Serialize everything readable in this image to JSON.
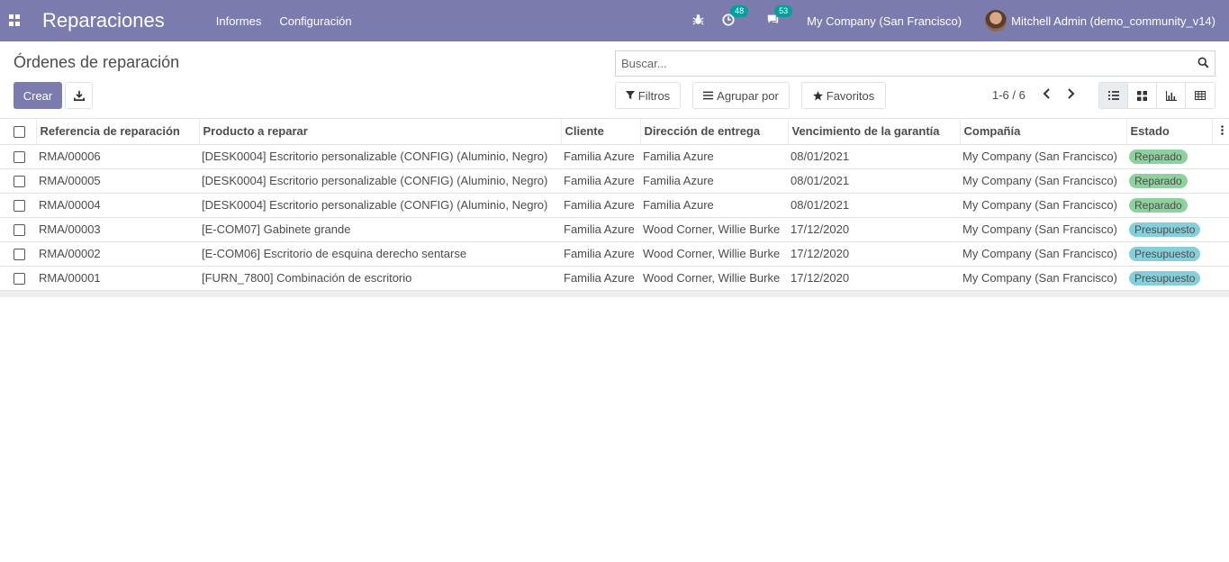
{
  "navbar": {
    "app_title": "Reparaciones",
    "menu": [
      "Informes",
      "Configuración"
    ],
    "activity_count": "48",
    "message_count": "53",
    "company": "My Company (San Francisco)",
    "user": "Mitchell Admin (demo_community_v14)",
    "color": "#7c7bad"
  },
  "control": {
    "breadcrumb": "Órdenes de reparación",
    "create_label": "Crear",
    "search_placeholder": "Buscar...",
    "filters_label": "Filtros",
    "group_by_label": "Agrupar por",
    "favorites_label": "Favoritos",
    "pager": "1-6 / 6"
  },
  "table": {
    "columns": [
      "Referencia de reparación",
      "Producto a reparar",
      "Cliente",
      "Dirección de entrega",
      "Vencimiento de la garantía",
      "Compañía",
      "Estado"
    ],
    "rows": [
      {
        "ref": "RMA/00006",
        "product": "[DESK0004] Escritorio personalizable (CONFIG) (Aluminio, Negro)",
        "client": "Familia Azure",
        "address": "Familia Azure",
        "warranty": "08/01/2021",
        "company": "My Company (San Francisco)",
        "status": "Reparado",
        "status_color": "#8fd19e"
      },
      {
        "ref": "RMA/00005",
        "product": "[DESK0004] Escritorio personalizable (CONFIG) (Aluminio, Negro)",
        "client": "Familia Azure",
        "address": "Familia Azure",
        "warranty": "08/01/2021",
        "company": "My Company (San Francisco)",
        "status": "Reparado",
        "status_color": "#8fd19e"
      },
      {
        "ref": "RMA/00004",
        "product": "[DESK0004] Escritorio personalizable (CONFIG) (Aluminio, Negro)",
        "client": "Familia Azure",
        "address": "Familia Azure",
        "warranty": "08/01/2021",
        "company": "My Company (San Francisco)",
        "status": "Reparado",
        "status_color": "#8fd19e"
      },
      {
        "ref": "RMA/00003",
        "product": "[E-COM07] Gabinete grande",
        "client": "Familia Azure",
        "address": "Wood Corner, Willie Burke",
        "warranty": "17/12/2020",
        "company": "My Company (San Francisco)",
        "status": "Presupuesto",
        "status_color": "#86cfda"
      },
      {
        "ref": "RMA/00002",
        "product": "[E-COM06] Escritorio de esquina derecho sentarse",
        "client": "Familia Azure",
        "address": "Wood Corner, Willie Burke",
        "warranty": "17/12/2020",
        "company": "My Company (San Francisco)",
        "status": "Presupuesto",
        "status_color": "#86cfda"
      },
      {
        "ref": "RMA/00001",
        "product": "[FURN_7800] Combinación de escritorio",
        "client": "Familia Azure",
        "address": "Wood Corner, Willie Burke",
        "warranty": "17/12/2020",
        "company": "My Company (San Francisco)",
        "status": "Presupuesto",
        "status_color": "#86cfda"
      }
    ]
  }
}
